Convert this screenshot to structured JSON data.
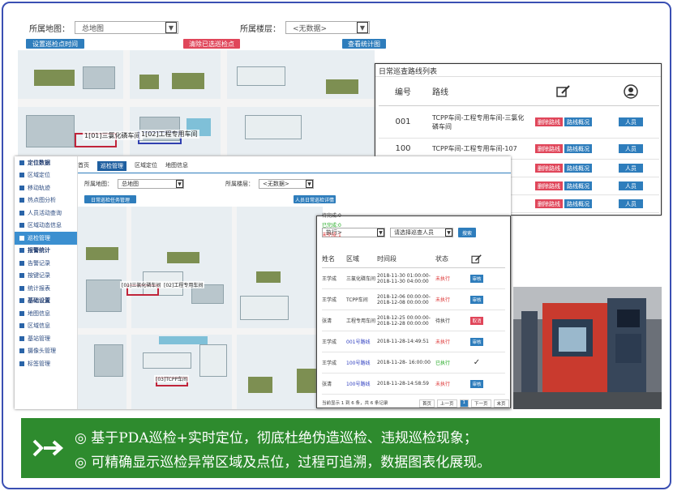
{
  "back": {
    "label_map": "所属地图：",
    "map_value": "总地图",
    "label_floor": "所属楼层：",
    "floor_value": "<无数据>",
    "btn_set_time": "设置巡检点时间",
    "btn_clear": "清除已选巡检点",
    "btn_stats": "查看统计图",
    "map_labels": [
      "1[01]三氯化磷车间",
      "1[02]工程专用车间"
    ]
  },
  "route_panel": {
    "title": "日常巡查路线列表",
    "col_no": "编号",
    "col_route": "路线",
    "rows": [
      {
        "no": "001",
        "route": "TCPP车间-工程专用车间-三氯化磷车间",
        "del": "删除路线",
        "info": "路线概况",
        "person": "人员"
      },
      {
        "no": "100",
        "route": "TCPP车间-工程专用车间-107",
        "del": "删除路线",
        "info": "路线概况",
        "person": "人员"
      },
      {
        "no": "",
        "route": "",
        "del": "删除路线",
        "info": "路线概况",
        "person": "人员"
      },
      {
        "no": "",
        "route": "",
        "del": "删除路线",
        "info": "路线概况",
        "person": "人员"
      },
      {
        "no": "",
        "route": "",
        "del": "删除路线",
        "info": "路线概况",
        "person": "人员"
      }
    ]
  },
  "front": {
    "sidebar": [
      {
        "label": "定位数据",
        "type": "sec"
      },
      {
        "label": "区域定位",
        "type": "item"
      },
      {
        "label": "移动轨迹",
        "type": "item"
      },
      {
        "label": "热点图分析",
        "type": "item"
      },
      {
        "label": "人员活动查询",
        "type": "item"
      },
      {
        "label": "区域动态信息",
        "type": "item"
      },
      {
        "label": "巡检管理",
        "type": "act"
      },
      {
        "label": "报警统计",
        "type": "sec"
      },
      {
        "label": "告警记录",
        "type": "item"
      },
      {
        "label": "按键记录",
        "type": "item"
      },
      {
        "label": "统计报表",
        "type": "item"
      },
      {
        "label": "基础设置",
        "type": "sec"
      },
      {
        "label": "地图信息",
        "type": "item"
      },
      {
        "label": "区域信息",
        "type": "item"
      },
      {
        "label": "基站管理",
        "type": "item"
      },
      {
        "label": "摄像头管理",
        "type": "item"
      },
      {
        "label": "标签管理",
        "type": "item"
      }
    ],
    "tabs": [
      "首页",
      "巡检管理",
      "区域定位",
      "地图信息"
    ],
    "label_map": "所属地图：",
    "map_value": "总地图",
    "label_floor": "所属楼层：",
    "floor_value": "<无数据>",
    "btn_daily": "日常巡检任务管理",
    "btn_person": "人员日常巡检详情",
    "map_labels": [
      "[01]三氯化磷车间",
      "[02]工程专用车间",
      "[03]TCPP车间"
    ]
  },
  "popup": {
    "status_pending": "待完成:0",
    "status_done": "已完成:0",
    "status_undone": "未完成:1",
    "filter_status": "执行>",
    "filter_person": "请选择巡查人员",
    "btn_search": "搜索",
    "col_name": "姓名",
    "col_area": "区域",
    "col_time": "时间段",
    "col_state": "状态",
    "rows": [
      {
        "name": "王学成",
        "area": "三氯化磷车间",
        "time": "2018-11-30 01:00:00-2018-11-30 04:00:00",
        "state": "未执行",
        "state_color": "#d33",
        "op": "审核",
        "op_type": "btn-blue"
      },
      {
        "name": "王学成",
        "area": "TCPP车间",
        "time": "2018-12-06 00:00:00-2018-12-08 00:00:00",
        "state": "未执行",
        "state_color": "#d33",
        "op": "审核",
        "op_type": "btn-blue"
      },
      {
        "name": "张清",
        "area": "工程专用车间",
        "time": "2018-12-25 00:00:00-2018-12-28 00:00:00",
        "state": "待执行",
        "state_color": "#333",
        "op": "取消",
        "op_type": "btn-red"
      },
      {
        "name": "王学成",
        "area": "001号路线",
        "time": "2018-11-28-14:49:51",
        "state": "未执行",
        "state_color": "#d33",
        "op": "审核",
        "op_type": "btn-blue"
      },
      {
        "name": "王学成",
        "area": "100号路线",
        "time": "2018-11-28- 16:00:00",
        "state": "已执行",
        "state_color": "#2a2",
        "op": "✓",
        "op_type": "check"
      },
      {
        "name": "张清",
        "area": "100号路线",
        "time": "2018-11-28-14:58:59",
        "state": "未执行",
        "state_color": "#d33",
        "op": "审核",
        "op_type": "btn-blue"
      }
    ],
    "footer": "当前显示 1 到 6 条，共 6 条记录",
    "pager": [
      "首页",
      "上一页",
      "1",
      "下一页",
      "末页"
    ]
  },
  "banner": {
    "line1": "◎ 基于PDA巡检+实时定位，彻底杜绝伪造巡检、违规巡检现象；",
    "line2": "◎ 可精确显示巡检异常区域及点位，过程可追溯，数据图表化展现。"
  },
  "colors": {
    "accent": "#2e7dbc",
    "danger": "#e0465a",
    "banner": "#2e8b2e"
  }
}
